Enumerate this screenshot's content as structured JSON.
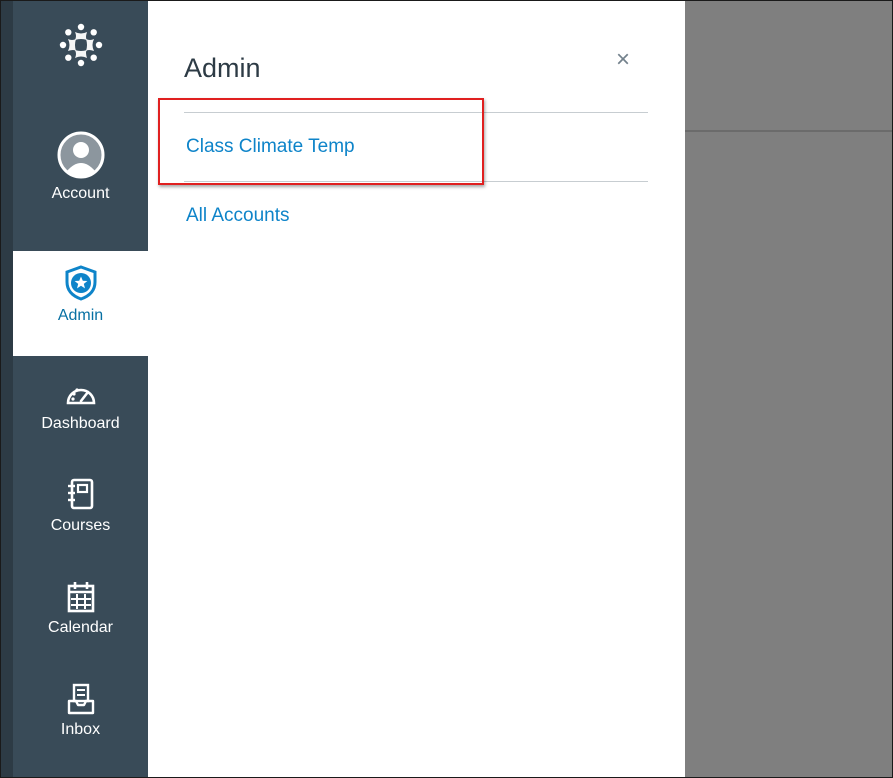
{
  "global_nav": {
    "logo_icon": "canvas-logo-icon",
    "items": [
      {
        "label": "Account",
        "icon": "user-avatar-icon",
        "active": false
      },
      {
        "label": "Admin",
        "icon": "shield-star-icon",
        "active": true
      },
      {
        "label": "Dashboard",
        "icon": "speedometer-icon",
        "active": false
      },
      {
        "label": "Courses",
        "icon": "notebook-icon",
        "active": false
      },
      {
        "label": "Calendar",
        "icon": "calendar-icon",
        "active": false
      },
      {
        "label": "Inbox",
        "icon": "inbox-icon",
        "active": false
      }
    ]
  },
  "tray": {
    "title": "Admin",
    "close_label": "×",
    "links": [
      {
        "label": "Class Climate Temp"
      },
      {
        "label": "All Accounts"
      }
    ]
  },
  "colors": {
    "nav_background": "#394b58",
    "active_item": "#0770a3",
    "link": "#0e84c9",
    "highlight": "#e02020",
    "overlay": "#7f7f7f"
  }
}
